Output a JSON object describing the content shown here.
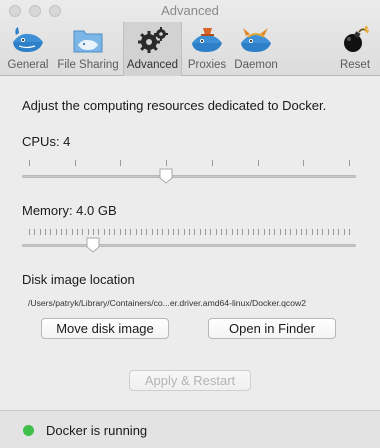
{
  "window": {
    "title": "Advanced"
  },
  "toolbar": {
    "items": [
      {
        "label": "General",
        "icon": "whale-icon"
      },
      {
        "label": "File Sharing",
        "icon": "folder-whale-icon"
      },
      {
        "label": "Advanced",
        "icon": "gears-icon",
        "selected": true
      },
      {
        "label": "Proxies",
        "icon": "proxy-whale-icon"
      },
      {
        "label": "Daemon",
        "icon": "daemon-whale-icon"
      },
      {
        "label": "Reset",
        "icon": "bomb-icon"
      }
    ]
  },
  "advanced": {
    "description": "Adjust the computing resources dedicated to Docker.",
    "cpus": {
      "label": "CPUs: 4",
      "value": 4,
      "min": 1,
      "max": 8
    },
    "memory": {
      "label": "Memory: 4.0 GB",
      "value_gb": 4.0,
      "min_gb": 1,
      "max_gb": 16
    },
    "disk": {
      "heading": "Disk image location",
      "path": "/Users/patryk/Library/Containers/co...er.driver.amd64-linux/Docker.qcow2",
      "move_button": "Move disk image",
      "open_button": "Open in Finder"
    },
    "apply_button": "Apply & Restart"
  },
  "status": {
    "text": "Docker is running",
    "color": "#3fc04a"
  },
  "colors": {
    "accent_blue": "#3d8fd6"
  }
}
